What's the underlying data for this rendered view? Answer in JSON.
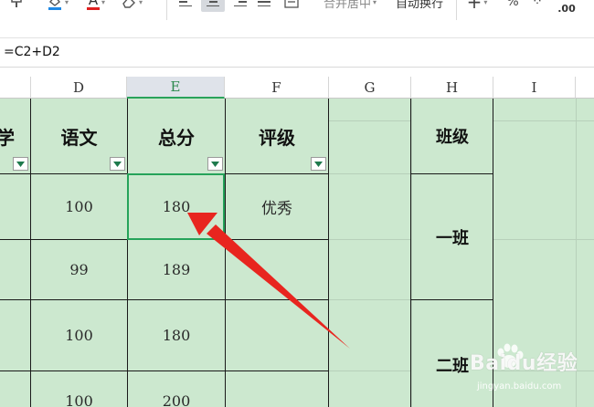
{
  "toolbar": {
    "merge_center_label": "合并居中",
    "wrap_text_label": "自动换行",
    "percent_symbol": "%",
    "decimal_label": ".00",
    "font_color_letter": "A",
    "accent_color": "#25a35a",
    "font_color_bar": "#e02020",
    "fill_color_bar": "#1e88e5"
  },
  "formula_bar": {
    "formula": "=C2+D2"
  },
  "columns": {
    "d": "D",
    "e": "E",
    "f": "F",
    "g": "G",
    "h": "H",
    "i": "I"
  },
  "table": {
    "headers": {
      "partial_c": "学",
      "chinese": "语文",
      "total": "总分",
      "rating": "评级",
      "class": "班级"
    },
    "rows": [
      {
        "chinese": "100",
        "total": "180",
        "rating": "优秀"
      },
      {
        "chinese": "99",
        "total": "189",
        "rating": ""
      },
      {
        "chinese": "100",
        "total": "180",
        "rating": ""
      },
      {
        "chinese": "100",
        "total": "200",
        "rating": ""
      }
    ],
    "classes": {
      "class_one": "一班",
      "class_two": "二班"
    }
  },
  "selection": {
    "active_cell": "E2"
  },
  "annotation": {
    "arrow_color": "#e8251f"
  },
  "watermark": {
    "text": "Baidu经验",
    "subtext": "jingyan.baidu.com"
  },
  "icons": [
    "format-painter-icon",
    "fill-color-icon",
    "font-color-icon",
    "eraser-icon",
    "align-left-icon",
    "align-center-icon",
    "align-right-icon",
    "justify-icon",
    "distributed-align-icon",
    "plus-icon",
    "percent-icon",
    "decimal-icon",
    "filter-dropdown-icon",
    "red-arrow-annotation",
    "baidu-paw-icon"
  ]
}
